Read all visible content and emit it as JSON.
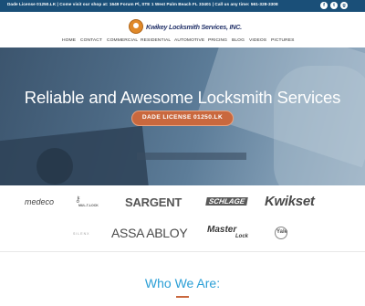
{
  "topbar": {
    "text": "Dade License 01250.LK  |  Come visit our shop at: 1649 Forum Pl, STE 1 West Palm Beach FL 33401  |  Call us any time: 561-328-3308",
    "social": [
      {
        "icon": "facebook-icon",
        "glyph": "f"
      },
      {
        "icon": "twitter-icon",
        "glyph": "t"
      },
      {
        "icon": "google-plus-icon",
        "glyph": "g"
      }
    ]
  },
  "header": {
    "logo_text": "Kwikey Locksmith Services, INC.",
    "nav": [
      "HOME",
      "CONTACT",
      "COMMERCIAL",
      "RESIDENTIAL",
      "AUTOMOTIVE",
      "PRICING",
      "BLOG",
      "VIDEOS",
      "PICTURES"
    ]
  },
  "hero": {
    "title": "Reliable and Awesome Locksmith Services",
    "button_label": "DADE LICENSE 01250.LK"
  },
  "brands": {
    "medeco": "medeco",
    "multlock": "MUL-T-LOCK",
    "sargent": "SARGENT",
    "schlage": "SCHLAGE",
    "kwikset": "Kwikset",
    "silenx": "SILENX",
    "assa_abloy": "ASSA ABLOY",
    "masterlock_top": "Master",
    "masterlock_bottom": "Lock",
    "yale": "Yale"
  },
  "section": {
    "title": "Who We Are:"
  },
  "colors": {
    "topbar": "#1a4f78",
    "accent": "#c9683e",
    "title_blue": "#2b9fd6"
  }
}
